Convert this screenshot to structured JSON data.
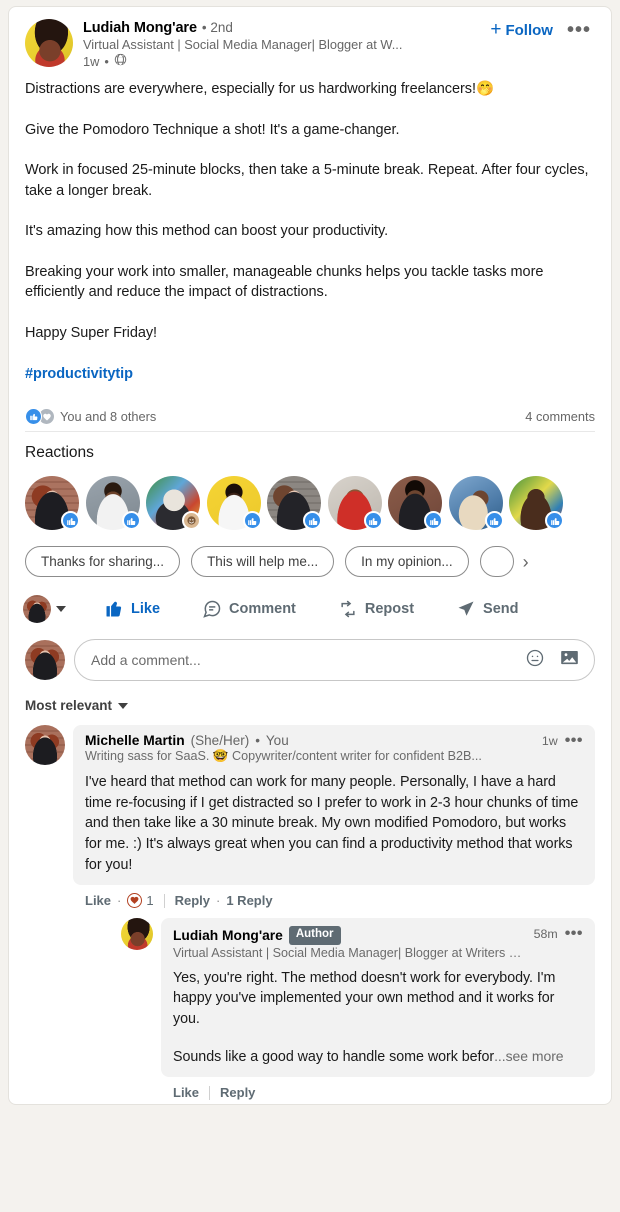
{
  "post": {
    "author": {
      "name": "Ludiah Mong'are",
      "degree": "• 2nd",
      "headline": "Virtual Assistant | Social Media Manager| Blogger at W...",
      "time": "1w",
      "visibility_icon": "globe-icon",
      "separator": "•"
    },
    "follow_label": "Follow",
    "follow_plus": "+",
    "more_menu": "•••",
    "body": [
      "Distractions are everywhere, especially for us hardworking freelancers!🤭",
      "",
      "Give the Pomodoro Technique a shot! It's a game-changer.",
      "Work in focused 25-minute blocks, then take a 5-minute break. Repeat. After four cycles, take a longer break.",
      "It's amazing how this method can boost your productivity.",
      "Breaking your work into smaller, manageable chunks helps you tackle tasks more efficiently and reduce the impact of distractions.",
      "Happy Super Friday!"
    ],
    "hashtag": "#productivitytip",
    "social": {
      "reaction_icons": [
        "like-icon",
        "support-icon"
      ],
      "count_text": "You and 8 others",
      "comments_text": "4 comments"
    }
  },
  "reactions": {
    "title": "Reactions",
    "avatars": [
      {
        "name": "reactor-1",
        "badge": "like-icon",
        "style": "ph-a1"
      },
      {
        "name": "reactor-2",
        "badge": "like-icon",
        "style": "ph-a2"
      },
      {
        "name": "reactor-3",
        "badge": "funny-icon",
        "style": "ph-a3"
      },
      {
        "name": "reactor-4",
        "badge": "like-icon",
        "style": "ph-a4"
      },
      {
        "name": "reactor-5",
        "badge": "like-icon",
        "style": "ph-a5"
      },
      {
        "name": "reactor-6",
        "badge": "like-icon",
        "style": "ph-a6"
      },
      {
        "name": "reactor-7",
        "badge": "like-icon",
        "style": "ph-a7"
      },
      {
        "name": "reactor-8",
        "badge": "like-icon",
        "style": "ph-a8"
      },
      {
        "name": "reactor-9",
        "badge": "like-icon",
        "style": "ph-a9"
      }
    ]
  },
  "quick_replies": {
    "chips": [
      "Thanks for sharing...",
      "This will help me...",
      "In my opinion..."
    ],
    "next_arrow": "›"
  },
  "actions": {
    "like": "Like",
    "comment": "Comment",
    "repost": "Repost",
    "send": "Send"
  },
  "comment_input": {
    "placeholder": "Add a comment...",
    "emoji_icon": "emoji-icon",
    "image_icon": "image-icon"
  },
  "sort": {
    "label": "Most relevant"
  },
  "comments": [
    {
      "name": "Michelle Martin",
      "pronoun": "(She/Her)",
      "separator": "•",
      "you_label": "You",
      "headline": "Writing sass for SaaS. 🤓 Copywriter/content writer for confident B2B...",
      "time": "1w",
      "more": "•••",
      "text": "I've heard that method can work for many people. Personally, I have a hard time re-focusing if I get distracted so I prefer to work in 2-3 hour chunks of time and then take like a 30 minute break. My own modified Pomodoro, but works for me. :) It's always great when you can find a productivity method that works for you!",
      "like_label": "Like",
      "reaction_count": "1",
      "reaction_icon": "love-heart-icon",
      "reply_label": "Reply",
      "replies_count_label": "1 Reply"
    }
  ],
  "reply": {
    "name": "Ludiah Mong'are",
    "author_badge": "Author",
    "headline": "Virtual Assistant | Social Media Manager| Blogger at Writers &...",
    "time": "58m",
    "more": "•••",
    "text_p1": "Yes, you're right. The method doesn't work for everybody. I'm happy you've implemented your own method and it works for you.",
    "text_p2": "Sounds like a good way to handle some work befor",
    "see_more": "...see more",
    "like_label": "Like",
    "reply_label": "Reply"
  },
  "colors": {
    "brand_blue": "#0a66c2",
    "like_blue": "#378fe9",
    "text_primary": "#1a1a1a",
    "text_secondary": "#666666",
    "page_bg": "#f4f2ee",
    "bubble_bg": "#f2f2f2",
    "author_badge_bg": "#5f6b73"
  }
}
